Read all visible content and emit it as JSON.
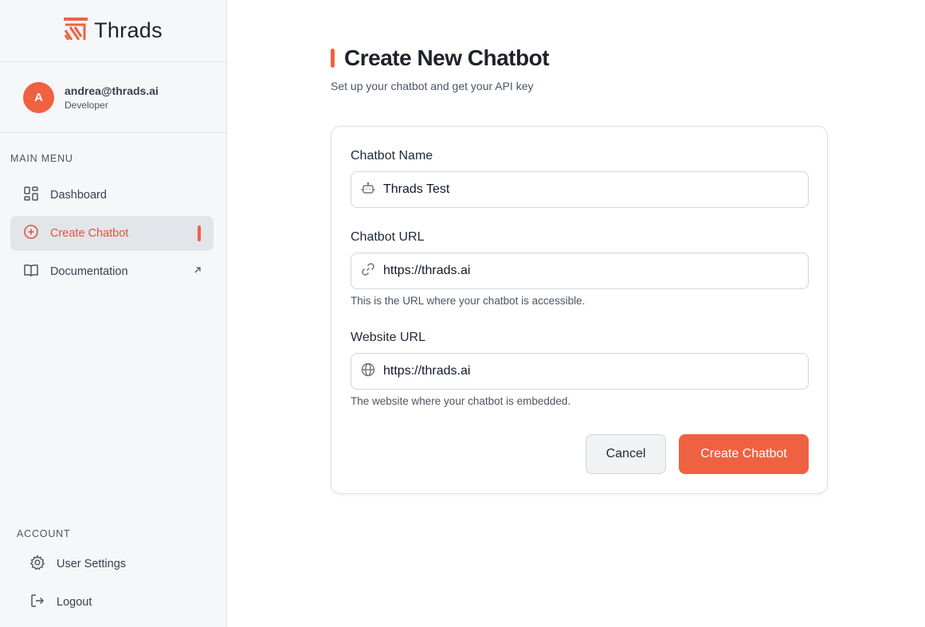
{
  "brand": {
    "name": "Thrads",
    "icon": "thrads-logo-icon",
    "color": "#ef6241"
  },
  "user": {
    "avatar_initial": "A",
    "email": "andrea@thrads.ai",
    "role": "Developer"
  },
  "sidebar": {
    "main_menu_title": "MAIN MENU",
    "items": [
      {
        "label": "Dashboard",
        "icon": "dashboard-icon",
        "active": false
      },
      {
        "label": "Create Chatbot",
        "icon": "plus-circle-icon",
        "active": true
      },
      {
        "label": "Documentation",
        "icon": "book-icon",
        "external": true
      }
    ],
    "account_title": "ACCOUNT",
    "account_items": [
      {
        "label": "User Settings",
        "icon": "gear-icon"
      },
      {
        "label": "Logout",
        "icon": "logout-icon"
      }
    ]
  },
  "page": {
    "title": "Create New Chatbot",
    "subtitle": "Set up your chatbot and get your API key"
  },
  "form": {
    "chatbot_name": {
      "label": "Chatbot Name",
      "value": "Thrads Test",
      "icon": "bot-icon"
    },
    "chatbot_url": {
      "label": "Chatbot URL",
      "value": "https://thrads.ai",
      "icon": "link-icon",
      "help": "This is the URL where your chatbot is accessible."
    },
    "website_url": {
      "label": "Website URL",
      "value": "https://thrads.ai",
      "icon": "globe-icon",
      "help": "The website where your chatbot is embedded."
    },
    "cancel_label": "Cancel",
    "submit_label": "Create Chatbot"
  },
  "colors": {
    "accent": "#ef6241",
    "active_bg": "#e2e5ea",
    "sidebar_bg": "#f6f7f9"
  }
}
